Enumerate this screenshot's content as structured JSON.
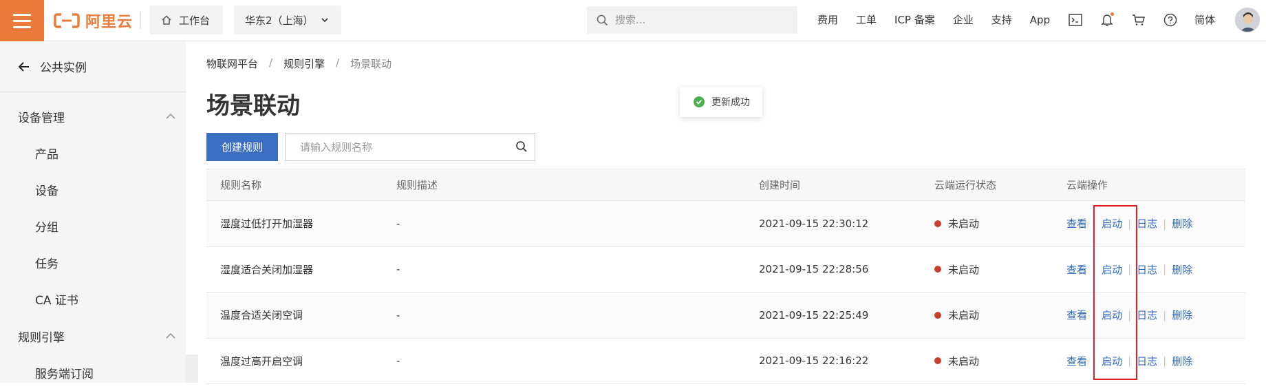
{
  "topbar": {
    "logo_text": "阿里云",
    "workbench_label": "工作台",
    "region_label": "华东2（上海）",
    "search_placeholder": "搜索...",
    "links": [
      "费用",
      "工单",
      "ICP 备案",
      "企业",
      "支持",
      "App"
    ],
    "lang_label": "简体",
    "brand_color": "#ea7b3a",
    "icons": [
      "terminal-icon",
      "bell-icon",
      "cart-icon",
      "help-icon"
    ]
  },
  "sidebar": {
    "back_label": "公共实例",
    "groups": [
      {
        "label": "设备管理",
        "items": [
          "产品",
          "设备",
          "分组",
          "任务",
          "CA 证书"
        ]
      },
      {
        "label": "规则引擎",
        "items": [
          "服务端订阅"
        ]
      }
    ]
  },
  "breadcrumb": [
    "物联网平台",
    "规则引擎",
    "场景联动"
  ],
  "page_title": "场景联动",
  "toast": {
    "text": "更新成功",
    "color": "#4caf50"
  },
  "create_button": "创建规则",
  "rule_search_placeholder": "请输入规则名称",
  "table": {
    "headers": [
      "规则名称",
      "规则描述",
      "创建时间",
      "云端运行状态",
      "云端操作"
    ],
    "rows": [
      {
        "name": "湿度过低打开加湿器",
        "desc": "-",
        "time": "2021-09-15 22:30:12",
        "status": "未启动"
      },
      {
        "name": "湿度适合关闭加湿器",
        "desc": "-",
        "time": "2021-09-15 22:28:56",
        "status": "未启动"
      },
      {
        "name": "温度合适关闭空调",
        "desc": "-",
        "time": "2021-09-15 22:25:49",
        "status": "未启动"
      },
      {
        "name": "温度过高开启空调",
        "desc": "-",
        "time": "2021-09-15 22:16:22",
        "status": "未启动"
      }
    ],
    "ops": [
      "查看",
      "启动",
      "日志",
      "删除"
    ],
    "link_color": "#2f6ac2",
    "status_color": "#c9412e"
  }
}
